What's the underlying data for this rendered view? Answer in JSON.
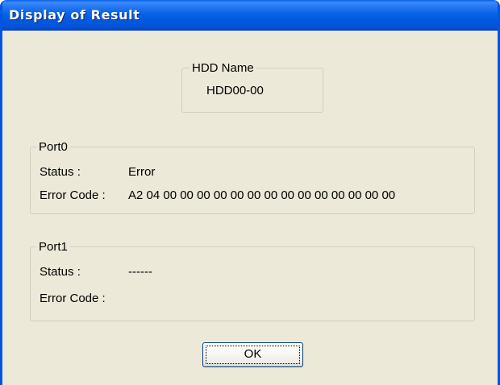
{
  "window": {
    "title": "Display of Result"
  },
  "hdd": {
    "group_label": "HDD Name",
    "value": "HDD00-00"
  },
  "port0": {
    "group_label": "Port0",
    "status_label": "Status :",
    "status_value": "Error",
    "error_code_label": "Error Code :",
    "error_code_value": "A2 04 00 00 00 00 00 00 00 00 00 00 00 00 00 00"
  },
  "port1": {
    "group_label": "Port1",
    "status_label": "Status :",
    "status_value": "------",
    "error_code_label": "Error Code :",
    "error_code_value": ""
  },
  "buttons": {
    "ok_label": "OK"
  },
  "colors": {
    "titlebar": "#0058e6",
    "dialog_background": "#ece9d8",
    "groupbox_border": "#d0d0bf"
  }
}
